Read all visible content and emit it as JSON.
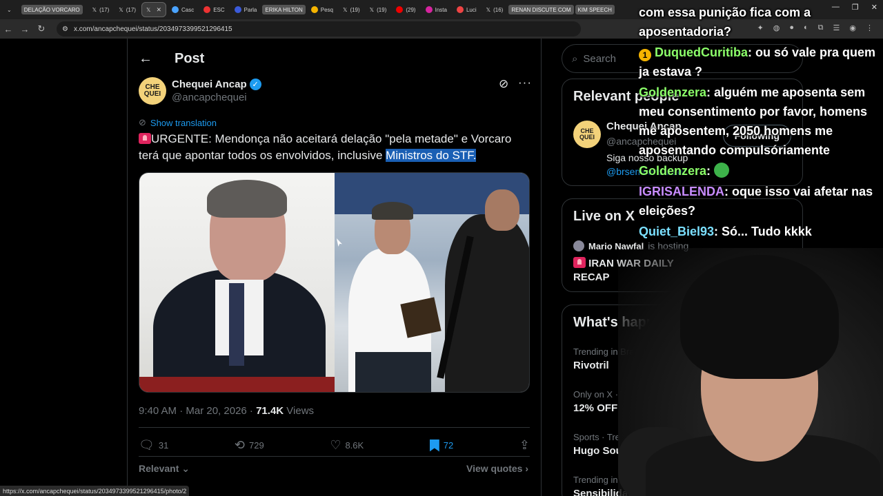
{
  "browser": {
    "tabs": [
      {
        "label": "DELAÇÃO VORCARO",
        "pill": true
      },
      {
        "label": "(17)"
      },
      {
        "label": "(17)"
      },
      {
        "label": "",
        "active": true
      },
      {
        "label": "Casc"
      },
      {
        "label": "ESC"
      },
      {
        "label": "Parla"
      },
      {
        "label": "ERIKA HILTON",
        "pill": true
      },
      {
        "label": "Pesq"
      },
      {
        "label": "(19)"
      },
      {
        "label": "(19)"
      },
      {
        "label": "(29)"
      },
      {
        "label": "Insta"
      },
      {
        "label": "Luci"
      },
      {
        "label": "(16)"
      },
      {
        "label": "RENAN DISCUTE COM",
        "pill": true
      },
      {
        "label": "KIM SPEECH",
        "pill": true
      }
    ],
    "url": "x.com/ancapchequei/status/2034973399521296415",
    "status_url": "https://x.com/ancapchequei/status/2034973399521296415/photo/2"
  },
  "post": {
    "header_title": "Post",
    "author": {
      "avatar_text": "CHE QUEI",
      "name": "Chequei Ancap",
      "handle": "@ancapchequei"
    },
    "show_translation": "Show translation",
    "text_before": "URGENTE: Mendonça não aceitará delação \"pela metade\" e Vorcaro terá que apontar todos os envolvidos, inclusive ",
    "text_highlight": "Ministros do STF.",
    "time": "9:40 AM · Mar 20, 2026 · ",
    "views_count": "71.4K",
    "views_label": " Views",
    "actions": {
      "replies": "31",
      "reposts": "729",
      "likes": "8.6K",
      "bookmarks": "72"
    },
    "relevant_label": "Relevant",
    "view_quotes_label": "View quotes"
  },
  "sidebar": {
    "search_placeholder": "Search",
    "relevant_people": {
      "title": "Relevant people",
      "name": "Chequei Ancap",
      "handle": "@ancapchequei",
      "bio": "Siga nosso backup",
      "bio_link": "@brsemcensuraof",
      "follow_label": "Following"
    },
    "live": {
      "title": "Live on X",
      "host": "Mario Nawfal",
      "status": "is hosting",
      "event": "IRAN WAR DAILY RECAP"
    },
    "happening": {
      "title": "What's happening",
      "trends": [
        {
          "context": "Trending in Brazil",
          "name": "Rivotril"
        },
        {
          "context": "Only on X · Trending",
          "name": "12% OFF"
        },
        {
          "context": "Sports · Trending",
          "name": "Hugo Souza"
        },
        {
          "context": "Trending in Brazil",
          "name": "Sensibilidade"
        }
      ]
    }
  },
  "chat": [
    {
      "user": "",
      "text": "com essa punição fica com a aposentadoria?"
    },
    {
      "user": "DuquedCuritiba",
      "text": ": ou só vale pra quem ja estava ?"
    },
    {
      "user": "Goldenzera",
      "text": ": alguém me aposenta sem meu consentimento por favor, homens me aposentem, 2050 homens me aposentando compulsóriamente"
    },
    {
      "user": "Goldenzera",
      "text": ":"
    },
    {
      "user": "IGRISALENDA",
      "text": ": oque isso vai afetar nas eleições?"
    },
    {
      "user": "Quiet_Biel93",
      "text": ": Só... Tudo kkkk"
    }
  ]
}
